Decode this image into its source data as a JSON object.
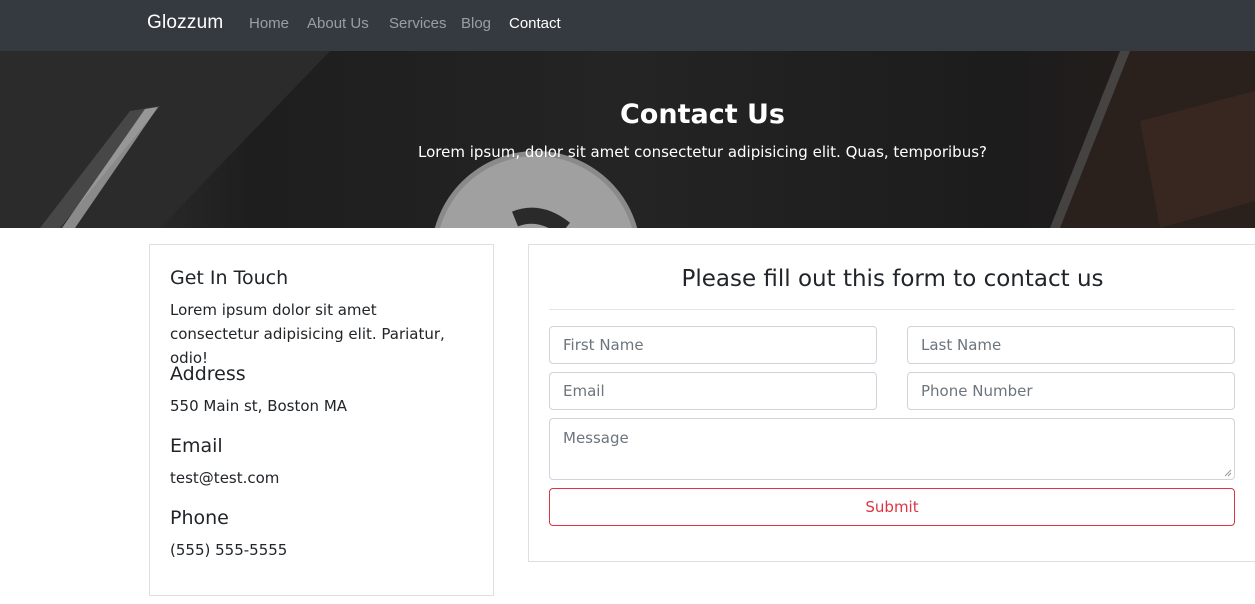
{
  "navbar": {
    "brand": "Glozzum",
    "links": [
      {
        "label": "Home",
        "active": false
      },
      {
        "label": "About Us",
        "active": false
      },
      {
        "label": "Services",
        "active": false
      },
      {
        "label": "Blog",
        "active": false
      },
      {
        "label": "Contact",
        "active": true
      }
    ]
  },
  "hero": {
    "title": "Contact Us",
    "subtitle": "Lorem ipsum, dolor sit amet consectetur adipisicing elit. Quas, temporibus?"
  },
  "info": {
    "get_in_touch": {
      "heading": "Get In Touch",
      "text": "Lorem ipsum dolor sit amet consectetur adipisicing elit. Pariatur, odio!"
    },
    "address": {
      "heading": "Address",
      "value": "550 Main st, Boston MA"
    },
    "email": {
      "heading": "Email",
      "value": "test@test.com"
    },
    "phone": {
      "heading": "Phone",
      "value": "(555) 555-5555"
    }
  },
  "form": {
    "title": "Please fill out this form to contact us",
    "first_name_placeholder": "First Name",
    "last_name_placeholder": "Last Name",
    "email_placeholder": "Email",
    "phone_placeholder": "Phone Number",
    "message_placeholder": "Message",
    "submit_label": "Submit"
  },
  "colors": {
    "navbar_bg": "#343a40",
    "danger": "#dc3545"
  }
}
